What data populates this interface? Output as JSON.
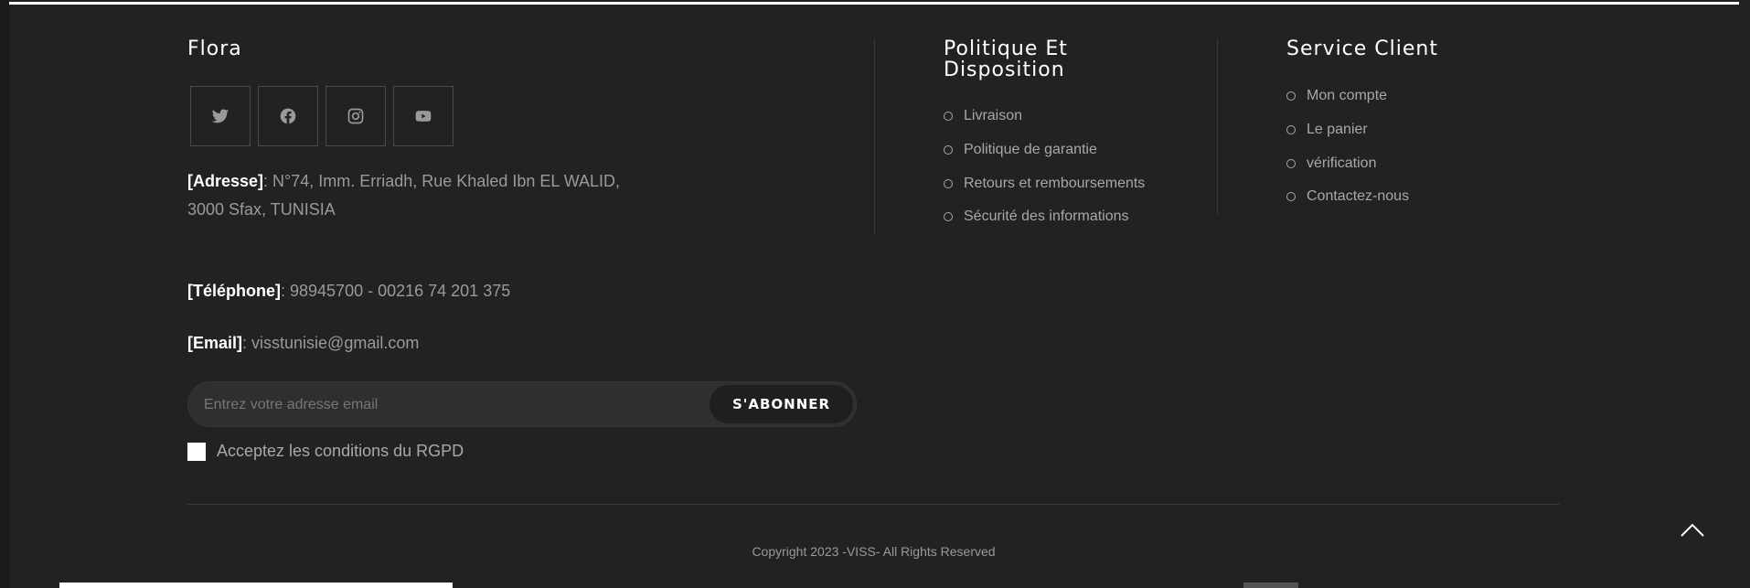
{
  "brand": {
    "title": "Flora"
  },
  "social": [
    {
      "icon": "twitter-icon"
    },
    {
      "icon": "facebook-icon"
    },
    {
      "icon": "instagram-icon"
    },
    {
      "icon": "youtube-icon"
    }
  ],
  "contact": {
    "address_label": "[Adresse]",
    "address_line1": ": N°74, Imm. Erriadh, Rue Khaled Ibn EL WALID,",
    "address_line2": "3000 Sfax, TUNISIA",
    "phone_label": "[Téléphone]",
    "phone_value": ": 98945700 - 00216 74 201 375",
    "email_label": "[Email]",
    "email_value": ": visstunisie@gmail.com"
  },
  "newsletter": {
    "placeholder": "Entrez votre adresse email",
    "button_label": "S'ABONNER",
    "gdpr_label": "Acceptez les conditions du RGPD"
  },
  "policy": {
    "title_line1": "Politique Et",
    "title_line2": "Disposition",
    "items": [
      "Livraison",
      "Politique de garantie",
      "Retours et remboursements",
      "Sécurité des informations"
    ]
  },
  "service": {
    "title": "Service Client",
    "items": [
      "Mon compte",
      "Le panier",
      "vérification",
      "Contactez-nous"
    ]
  },
  "copyright": "Copyright 2023 -VISS- All Rights Reserved",
  "colors": {
    "background": "#222222",
    "text_muted": "#9a9a9a",
    "heading": "#ffffff"
  }
}
